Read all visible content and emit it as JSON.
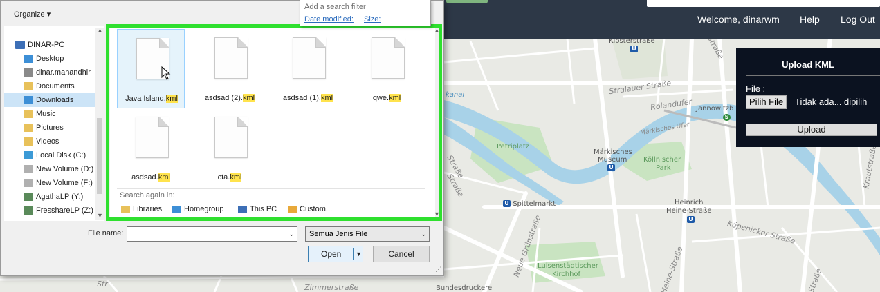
{
  "header": {
    "welcome": "Welcome, dinarwm",
    "help": "Help",
    "logout": "Log Out"
  },
  "upload_panel": {
    "title": "Upload KML",
    "file_label": "File :",
    "choose_button": "Pilih File",
    "no_file": "Tidak ada... dipilih",
    "upload_button": "Upload"
  },
  "search_popup": {
    "placeholder": "Add a search filter",
    "options": [
      "Date modified:",
      "Size:"
    ]
  },
  "dialog": {
    "organize": "Organize ▾",
    "nav_items": [
      {
        "label": "DINAR-PC",
        "icon": "computer-icon",
        "color": "#3d6fb6"
      },
      {
        "label": "Desktop",
        "icon": "desktop-folder-icon",
        "color": "#3d8fd6"
      },
      {
        "label": "dinar.mahandhir",
        "icon": "user-folder-icon",
        "color": "#8a8a8a"
      },
      {
        "label": "Documents",
        "icon": "documents-folder-icon",
        "color": "#e8c15a"
      },
      {
        "label": "Downloads",
        "icon": "downloads-folder-icon",
        "color": "#3d8fd6"
      },
      {
        "label": "Music",
        "icon": "music-folder-icon",
        "color": "#e8c15a"
      },
      {
        "label": "Pictures",
        "icon": "pictures-folder-icon",
        "color": "#e8c15a"
      },
      {
        "label": "Videos",
        "icon": "videos-folder-icon",
        "color": "#e8c15a"
      },
      {
        "label": "Local Disk (C:)",
        "icon": "local-disk-icon",
        "color": "#3c9ad6"
      },
      {
        "label": "New Volume (D:)",
        "icon": "drive-icon",
        "color": "#b0b0b0"
      },
      {
        "label": "New Volume (F:)",
        "icon": "drive-icon",
        "color": "#b0b0b0"
      },
      {
        "label": "AgathaLP (Y:)",
        "icon": "network-drive-icon",
        "color": "#5a8a5a"
      },
      {
        "label": "FresshareLP (Z:)",
        "icon": "network-drive-icon",
        "color": "#5a8a5a"
      }
    ],
    "files": [
      {
        "name": "Java Island.",
        "ext": "kml"
      },
      {
        "name": "asdsad (2).",
        "ext": "kml"
      },
      {
        "name": "asdsad (1).",
        "ext": "kml"
      },
      {
        "name": "qwe.",
        "ext": "kml"
      },
      {
        "name": "asdsad.",
        "ext": "kml"
      },
      {
        "name": "cta.",
        "ext": "kml"
      }
    ],
    "search_again_label": "Search again in:",
    "search_again": [
      {
        "label": "Libraries",
        "icon": "libraries-icon",
        "color": "#e8c15a"
      },
      {
        "label": "Homegroup",
        "icon": "homegroup-icon",
        "color": "#3d8fd6"
      },
      {
        "label": "This PC",
        "icon": "this-pc-icon",
        "color": "#3d6fb6"
      },
      {
        "label": "Custom...",
        "icon": "custom-folder-icon",
        "color": "#e8a93a"
      }
    ],
    "filename_label": "File name:",
    "filename_value": "",
    "filetype": "Semua Jenis File",
    "open_button": "Open",
    "cancel_button": "Cancel"
  },
  "map": {
    "labels": {
      "klosterstrasse": "Klosterstraße",
      "stralauer": "Stralauer Straße",
      "rolandufer": "Rolandufer",
      "jannowitz": "Jannowitzb",
      "maerkisches_ufer": "Märkisches Ufer",
      "kanal": "kanal",
      "petriplatz": "Petriplatz",
      "museum_1": "Märkisches",
      "museum_2": "Museum",
      "koellnischer_1": "Köllnischer",
      "koellnischer_2": "Park",
      "spittelmarkt": "Spittelmarkt",
      "heinrich_1": "Heinrich",
      "heinrich_2": "Heine-Straße",
      "koepenicker": "Köpenicker Straße",
      "neue_gruenstr": "Neue Grünstraße",
      "heine_str": "Heine-Straße",
      "luisenst_1": "Luisenstädtischer",
      "luisenst_2": "Kirchhof",
      "zimmerstr": "Zimmerstraße",
      "bundesdruckerei": "Bundesdruckerei",
      "krautstr": "Krautstraße",
      "strasse_1": "Straße",
      "strasse_2": "Straße",
      "str_left": "Str",
      "str_top": "Straße",
      "str_gr": "Straße",
      "ubahn": "U",
      "sbahn": "S"
    }
  }
}
